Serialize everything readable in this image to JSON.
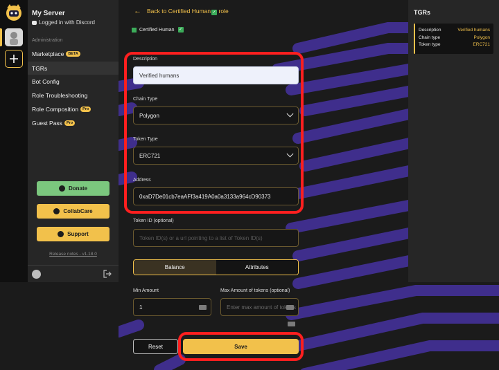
{
  "server": {
    "name": "My Server",
    "login_status": "Logged in with Discord"
  },
  "sidebar": {
    "section_heading": "Administration",
    "items": [
      {
        "label": "Marketplace",
        "badge": "BETA"
      },
      {
        "label": "TGRs",
        "badge": ""
      },
      {
        "label": "Bot Config",
        "badge": ""
      },
      {
        "label": "Role Troubleshooting",
        "badge": ""
      },
      {
        "label": "Role Composition",
        "badge": "Pro"
      },
      {
        "label": "Guest Pass",
        "badge": "Pro"
      }
    ],
    "buttons": {
      "donate": "Donate",
      "collabcare": "CollabCare",
      "support": "Support"
    },
    "release_notes": "Release notes - v1.18.0"
  },
  "main": {
    "back_link": "Back to Certified Human",
    "back_suffix": "role",
    "crumb": "Certified Human",
    "form": {
      "description": {
        "label": "Description",
        "value": "Verified humans"
      },
      "chain_type": {
        "label": "Chain Type",
        "value": "Polygon"
      },
      "token_type": {
        "label": "Token Type",
        "value": "ERC721"
      },
      "address": {
        "label": "Address",
        "value": "0xaD7De01cb7eaAFf3a419A0a0a3133a964cD90373"
      },
      "token_id": {
        "label": "Token ID (optional)",
        "placeholder": "Token ID(s) or a url pointing to a list of Token ID(s)"
      },
      "tabs": [
        "Balance",
        "Attributes"
      ],
      "min_amount": {
        "label": "Min Amount",
        "value": "1"
      },
      "max_amount": {
        "label": "Max Amount of tokens (optional)",
        "placeholder": "Enter max amount of tokens"
      },
      "reset_label": "Reset",
      "save_label": "Save"
    }
  },
  "right_panel": {
    "title": "TGRs",
    "rows": [
      {
        "key": "Description",
        "value": "Verified humans"
      },
      {
        "key": "Chain type",
        "value": "Polygon"
      },
      {
        "key": "Token type",
        "value": "ERC721"
      }
    ]
  },
  "colors": {
    "accent": "#f2c14b",
    "highlight": "#ff1f1f",
    "pattern": "#3f2e8c",
    "donate": "#7bc77e"
  }
}
